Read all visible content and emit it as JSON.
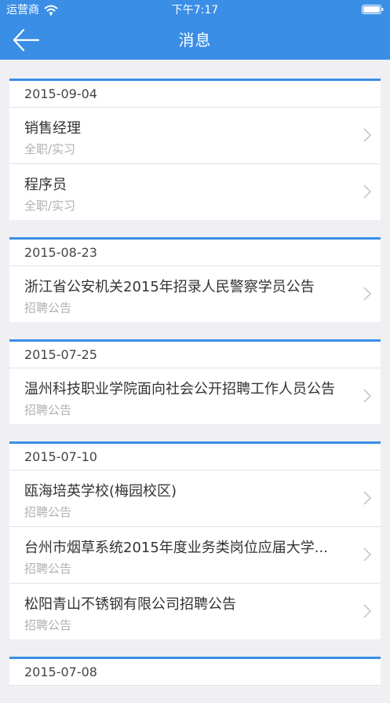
{
  "status_bar": {
    "carrier": "运营商",
    "time": "下午7:17"
  },
  "nav": {
    "title": "消息",
    "back_icon": "arrow-left-icon"
  },
  "groups": [
    {
      "date": "2015-09-04",
      "items": [
        {
          "title": "销售经理",
          "subtitle": "全职/实习"
        },
        {
          "title": "程序员",
          "subtitle": "全职/实习"
        }
      ]
    },
    {
      "date": "2015-08-23",
      "items": [
        {
          "title": "浙江省公安机关2015年招录人民警察学员公告",
          "subtitle": "招聘公告"
        }
      ]
    },
    {
      "date": "2015-07-25",
      "items": [
        {
          "title": "温州科技职业学院面向社会公开招聘工作人员公告",
          "subtitle": "招聘公告"
        }
      ]
    },
    {
      "date": "2015-07-10",
      "items": [
        {
          "title": "瓯海培英学校(梅园校区)",
          "subtitle": "招聘公告"
        },
        {
          "title": "台州市烟草系统2015年度业务类岗位应届大学...",
          "subtitle": "招聘公告"
        },
        {
          "title": "松阳青山不锈钢有限公司招聘公告",
          "subtitle": "招聘公告"
        }
      ]
    },
    {
      "date": "2015-07-08",
      "items": []
    }
  ],
  "colors": {
    "accent": "#3a8ee6",
    "background": "#efeff4",
    "subtitle": "#b0b0b0"
  }
}
